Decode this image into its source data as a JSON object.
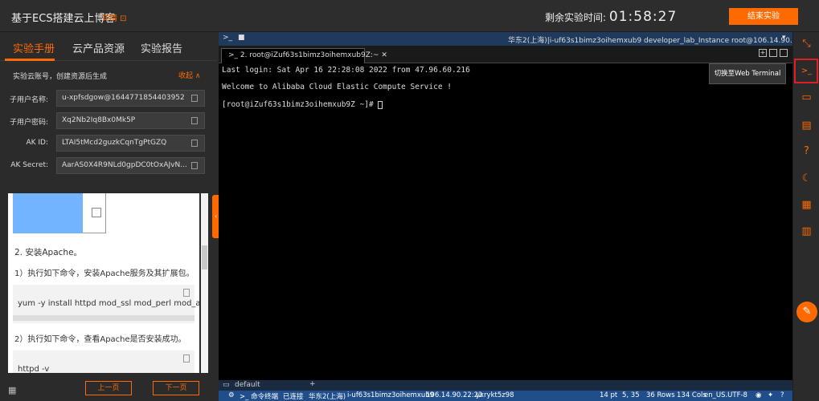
{
  "header": {
    "title": "基于ECS搭建云上博客",
    "detail": "详情 ⊡",
    "remaining_label": "剩余实验时间:",
    "hours": "01",
    "minutes": "58",
    "seconds": "27",
    "end_button": "结束实验"
  },
  "left_tabs": [
    "实验手册",
    "云产品资源",
    "实验报告"
  ],
  "account": {
    "title": "实验云账号，创建资源后生成",
    "collapse": "收起",
    "fields": [
      {
        "label": "子用户名称:",
        "value": "u-xpfsdgow@1644771854403952"
      },
      {
        "label": "子用户密码:",
        "value": "Xq2Nb2Iq8Bx0Mk5P"
      },
      {
        "label": "AK ID:",
        "value": "LTAI5tMcd2guzkCqnTgPtGZQ"
      },
      {
        "label": "AK Secret:",
        "value": "AarAS0X4R9NLd0gpDC0tOxAJvN..."
      }
    ]
  },
  "doc": {
    "step2": "2. 安装Apache。",
    "step2_1": "1）执行如下命令，安装Apache服务及其扩展包。",
    "cmd1": "yum -y install httpd mod_ssl mod_perl mod_auth_m",
    "step2_2": "2）执行如下命令，查看Apache是否安装成功。",
    "cmd2": "httpd -v"
  },
  "pager": {
    "prev": "上一页",
    "next": "下一页"
  },
  "terminal": {
    "header_right": "华东2(上海)|i-uf63s1bimz3oihemxub9   developer_lab_Instance   root@106.14.90.22",
    "tab_title": "2. root@iZuf63s1bimz3oihemxub9Z:~",
    "lines": [
      "Last login: Sat Apr 16 22:28:08 2022 from 47.96.60.216",
      "",
      "Welcome to Alibaba Cloud Elastic Compute Service !",
      "",
      "[root@iZuf63s1bimz3oihemxub9Z ~]# "
    ],
    "session": "default",
    "status": {
      "type": "命令终端",
      "conn": "已连接",
      "region": "华东2(上海)",
      "instance": "i-uf63s1bimz3oihemxub9",
      "ip": "106.14.90.22:22",
      "user": "yxrykt5z98",
      "font": "14 pt",
      "pos": "5, 35",
      "rows": "36 Rows",
      "cols": "134 Cols",
      "enc": "en_US.UTF-8"
    }
  },
  "tooltip": "切换至Web Terminal",
  "accent": "#ff6a00"
}
